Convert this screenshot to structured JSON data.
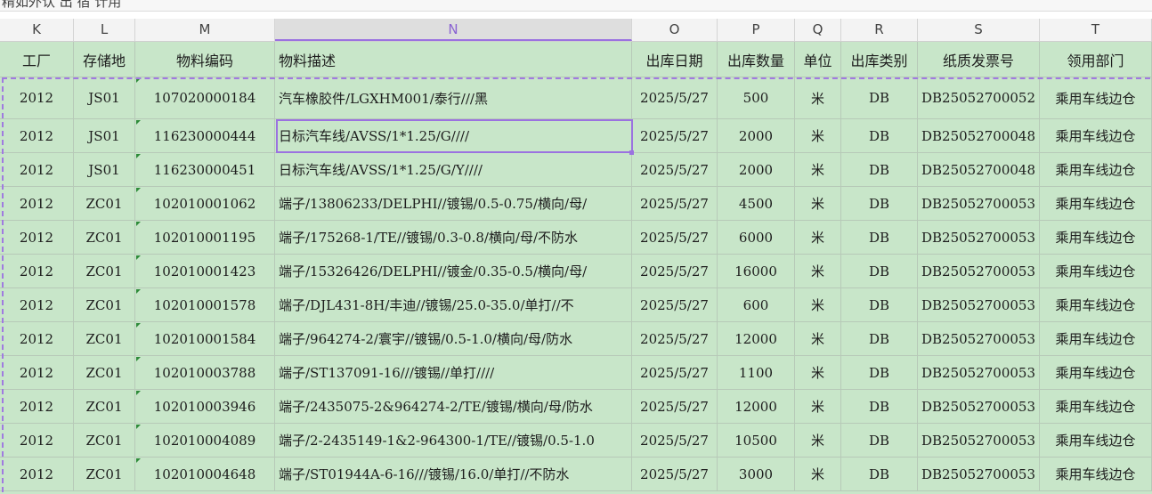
{
  "top_partial_text": "精如外认 出 宿 计用",
  "column_letters": [
    "K",
    "L",
    "M",
    "N",
    "O",
    "P",
    "Q",
    "R",
    "S",
    "T"
  ],
  "active_column": "N",
  "header": [
    "工厂",
    "存储地",
    "物料编码",
    "物料描述",
    "出库日期",
    "出库数量",
    "单位",
    "出库类别",
    "纸质发票号",
    "领用部门"
  ],
  "rows": [
    [
      "2012",
      "JS01",
      "107020000184",
      "汽车橡胶件/LGXHM001/泰行///黑",
      "2025/5/27",
      "500",
      "米",
      "DB",
      "DB25052700052",
      "乘用车线边仓"
    ],
    [
      "2012",
      "JS01",
      "116230000444",
      "日标汽车线/AVSS/1*1.25/G////",
      "2025/5/27",
      "2000",
      "米",
      "DB",
      "DB25052700048",
      "乘用车线边仓"
    ],
    [
      "2012",
      "JS01",
      "116230000451",
      "日标汽车线/AVSS/1*1.25/G/Y////",
      "2025/5/27",
      "2000",
      "米",
      "DB",
      "DB25052700048",
      "乘用车线边仓"
    ],
    [
      "2012",
      "ZC01",
      "102010001062",
      "端子/13806233/DELPHI//镀锡/0.5-0.75/横向/母/",
      "2025/5/27",
      "4500",
      "米",
      "DB",
      "DB25052700053",
      "乘用车线边仓"
    ],
    [
      "2012",
      "ZC01",
      "102010001195",
      "端子/175268-1/TE//镀锡/0.3-0.8/横向/母/不防水",
      "2025/5/27",
      "6000",
      "米",
      "DB",
      "DB25052700053",
      "乘用车线边仓"
    ],
    [
      "2012",
      "ZC01",
      "102010001423",
      "端子/15326426/DELPHI//镀金/0.35-0.5/横向/母/",
      "2025/5/27",
      "16000",
      "米",
      "DB",
      "DB25052700053",
      "乘用车线边仓"
    ],
    [
      "2012",
      "ZC01",
      "102010001578",
      "端子/DJL431-8H/丰迪//镀锡/25.0-35.0/单打//不",
      "2025/5/27",
      "600",
      "米",
      "DB",
      "DB25052700053",
      "乘用车线边仓"
    ],
    [
      "2012",
      "ZC01",
      "102010001584",
      "端子/964274-2/寰宇//镀锡/0.5-1.0/横向/母/防水",
      "2025/5/27",
      "12000",
      "米",
      "DB",
      "DB25052700053",
      "乘用车线边仓"
    ],
    [
      "2012",
      "ZC01",
      "102010003788",
      "端子/ST137091-16///镀锡//单打////",
      "2025/5/27",
      "1100",
      "米",
      "DB",
      "DB25052700053",
      "乘用车线边仓"
    ],
    [
      "2012",
      "ZC01",
      "102010003946",
      "端子/2435075-2&964274-2/TE/镀锡/横向/母/防水",
      "2025/5/27",
      "12000",
      "米",
      "DB",
      "DB25052700053",
      "乘用车线边仓"
    ],
    [
      "2012",
      "ZC01",
      "102010004089",
      "端子/2-2435149-1&2-964300-1/TE//镀锡/0.5-1.0",
      "2025/5/27",
      "10500",
      "米",
      "DB",
      "DB25052700053",
      "乘用车线边仓"
    ],
    [
      "2012",
      "ZC01",
      "102010004648",
      "端子/ST01944A-6-16///镀锡/16.0/单打//不防水",
      "2025/5/27",
      "3000",
      "米",
      "DB",
      "DB25052700053",
      "乘用车线边仓"
    ]
  ],
  "colors": {
    "cell_fill": "#c8e6c9",
    "selection": "#9b72e0",
    "comment_marker": "#2e8b3a"
  }
}
